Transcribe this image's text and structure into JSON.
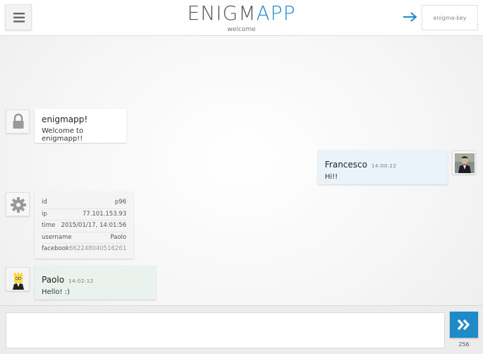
{
  "header": {
    "logo_part1": "ENIGM",
    "logo_part2": "APP",
    "subtitle": "welcome",
    "key_placeholder": "enigma-key"
  },
  "messages": {
    "system": {
      "title": "enigmapp!",
      "text": "Welcome to enigmapp!!"
    },
    "francesco": {
      "name": "Francesco",
      "time": "14:00:22",
      "text": "Hi!!"
    },
    "info": {
      "rows": [
        {
          "key": "id",
          "value": "p96"
        },
        {
          "key": "ip",
          "value": "77.101.153.93"
        },
        {
          "key": "time",
          "value": "2015/01/17, 14:01:56"
        },
        {
          "key": "username",
          "value": "Paolo"
        },
        {
          "key": "facebook",
          "value": "662248040516261"
        }
      ]
    },
    "paolo": {
      "name": "Paolo",
      "time": "14:02:12",
      "text": "Hello! :)"
    }
  },
  "composer": {
    "counter": "256"
  },
  "colors": {
    "accent": "#1f8ac8",
    "francesco_bubble": "#eaf3f9",
    "paolo_bubble": "#e9f2ed"
  }
}
